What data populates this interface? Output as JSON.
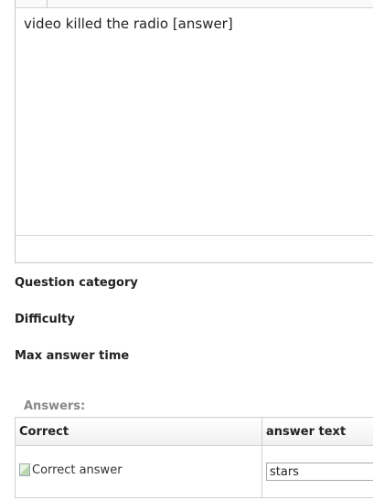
{
  "editor": {
    "content": "video killed the radio [answer]"
  },
  "fields": {
    "question_category": "Question category",
    "difficulty": "Difficulty",
    "max_answer_time": "Max answer time"
  },
  "answers": {
    "title": "Answers:",
    "columns": {
      "correct": "Correct",
      "answer_text": "answer text"
    },
    "rows": [
      {
        "correct_img_alt": "Correct answer",
        "answer_text": "stars"
      }
    ]
  }
}
